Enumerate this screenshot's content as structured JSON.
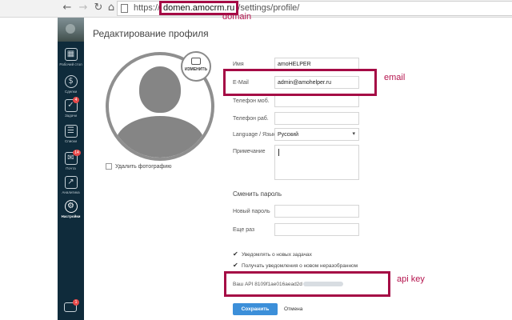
{
  "browser": {
    "back_icon": "back-arrow-icon",
    "forward_icon": "forward-arrow-icon",
    "reload_icon": "reload-icon",
    "home_icon": "home-icon",
    "url_scheme": "https://",
    "url_host": "domen.amocrm.ru",
    "url_path": "/settings/profile/"
  },
  "sidebar": {
    "items": [
      {
        "label": "Рабочий стол",
        "icon": "dashboard-icon"
      },
      {
        "label": "Сделки",
        "icon": "dollar-icon"
      },
      {
        "label": "Задачи",
        "icon": "tasks-icon",
        "badge": "4"
      },
      {
        "label": "Списки",
        "icon": "lists-icon"
      },
      {
        "label": "Почта",
        "icon": "mail-icon",
        "badge": "14"
      },
      {
        "label": "Аналитика",
        "icon": "analytics-icon"
      },
      {
        "label": "Настройки",
        "icon": "settings-icon",
        "active": true
      }
    ],
    "chat_badge": "1"
  },
  "page": {
    "title": "Редактирование профиля",
    "change_photo_label": "ИЗМЕНИТЬ",
    "delete_photo_label": "Удалить фотографию"
  },
  "form": {
    "name_label": "Имя",
    "name_value": "amoHELPER",
    "email_label": "E-Mail",
    "email_value": "admin@amohelper.ru",
    "mobile_label": "Телефон моб.",
    "work_phone_label": "Телефон раб.",
    "language_label": "Language / Язык",
    "language_value": "Русский",
    "note_label": "Примечание",
    "password_section": "Сменить пароль",
    "new_password_label": "Новый пароль",
    "repeat_label": "Еще раз",
    "notify_tasks": "Уведомлять о новых задачах",
    "notify_unsorted": "Получать уведомления о новом неразобранном",
    "api_label": "Ваш API",
    "api_key_visible": "8109f1ae016aead2d",
    "save_label": "Сохранить",
    "cancel_label": "Отмена"
  },
  "annotations": {
    "domain": "domain",
    "email": "email",
    "api_key": "api key",
    "color": "#a50b45"
  }
}
